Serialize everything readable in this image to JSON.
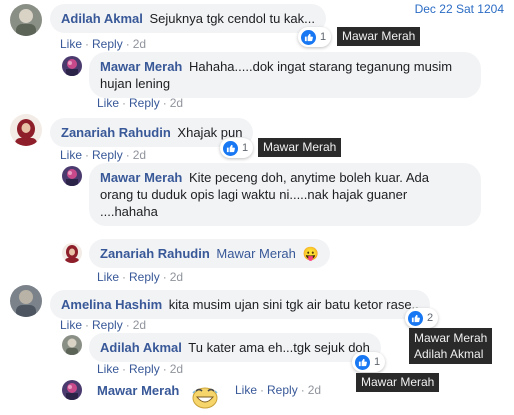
{
  "date_label": "Dec 22 Sat 1204",
  "comments": [
    {
      "author": "Adilah Akmal",
      "text": "Sejuknya tgk cendol tu kak...",
      "like": "Like",
      "reply": "Reply",
      "time": "2d",
      "reaction_count": "1",
      "tooltip": "Mawar Merah"
    },
    {
      "author": "Mawar Merah",
      "text_line1": "Hahaha.....dok ingat starang teganung musim",
      "text_line2": "hujan lening",
      "like": "Like",
      "reply": "Reply",
      "time": "2d"
    },
    {
      "author": "Zanariah Rahudin",
      "text": "Xhajak pun",
      "like": "Like",
      "reply": "Reply",
      "time": "2d",
      "reaction_count": "1",
      "tooltip": "Mawar Merah"
    },
    {
      "author": "Mawar Merah",
      "text_line1": "Kite peceng doh, anytime boleh kuar. Ada",
      "text_line2": "orang tu duduk opis lagi waktu ni.....nak hajak guaner",
      "text_line3": "....hahaha",
      "like": "Like",
      "reply": "Reply",
      "time": "2d"
    },
    {
      "author": "Zanariah Rahudin",
      "text": "Mawar Merah",
      "emoji": "😛",
      "like": "Like",
      "reply": "Reply",
      "time": "2d"
    },
    {
      "author": "Amelina Hashim",
      "text": "kita musim ujan sini tgk air batu ketor rase..",
      "like": "Like",
      "reply": "Reply",
      "time": "2d",
      "reaction_count": "2",
      "tooltip_line1": "Mawar Merah",
      "tooltip_line2": "Adilah Akmal"
    },
    {
      "author": "Adilah Akmal",
      "text": "Tu kater ama eh...tgk sejuk doh",
      "like": "Like",
      "reply": "Reply",
      "time": "2d",
      "reaction_count": "1",
      "tooltip": "Mawar Merah"
    },
    {
      "author": "Mawar Merah",
      "sticker": "grinning-face-sticker",
      "like": "Like",
      "reply": "Reply",
      "time": "2d"
    }
  ]
}
